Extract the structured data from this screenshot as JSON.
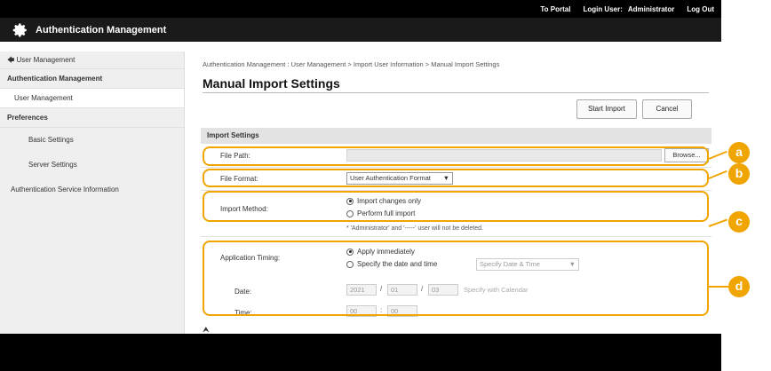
{
  "topbar": {
    "portal": "To Portal",
    "login_label": "Login User:",
    "login_user": "Administrator",
    "logout": "Log Out"
  },
  "header": {
    "app_title": "Authentication Management",
    "icon": "gear-icon"
  },
  "sidebar": {
    "back": "User Management",
    "section1": "Authentication Management",
    "item_user_mgmt": "User Management",
    "section2": "Preferences",
    "item_basic": "Basic Settings",
    "item_server": "Server Settings",
    "item_auth_info": "Authentication Service Information"
  },
  "main": {
    "breadcrumb": "Authentication Management : User Management > Import User Information > Manual Import Settings",
    "title": "Manual Import Settings",
    "start_import": "Start Import",
    "cancel": "Cancel",
    "section_title": "Import Settings",
    "file_path_label": "File Path:",
    "file_path_value": "",
    "browse": "Browse...",
    "file_format_label": "File Format:",
    "file_format_value": "User Authentication Format",
    "import_method_label": "Import Method:",
    "import_changes": "Import changes only",
    "full_import": "Perform full import",
    "note": "* 'Administrator' and '-----' user will not be deleted.",
    "timing_label": "Application Timing:",
    "apply_immediately": "Apply immediately",
    "specify_datetime": "Specify the date and time",
    "specify_select": "Specify Date & Time",
    "date_label": "Date:",
    "year": "2021",
    "month": "01",
    "day": "03",
    "calendar": "Specify with Calendar",
    "time_label": "Time:",
    "hour": "00",
    "minute": "00",
    "to_top": "⮝"
  },
  "callouts": {
    "a": "a",
    "b": "b",
    "c": "c",
    "d": "d",
    "color": "#f0a500"
  }
}
